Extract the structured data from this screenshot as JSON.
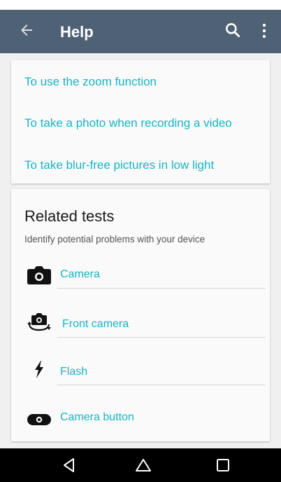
{
  "app_bar": {
    "title": "Help",
    "back_icon": "arrow-back-icon",
    "search_icon": "search-icon",
    "more_icon": "more-vertical-icon",
    "color": "#4f6175"
  },
  "topics": [
    {
      "label": "To use the zoom function"
    },
    {
      "label": "To take a photo when recording a video"
    },
    {
      "label": "To take blur-free pictures in low light"
    }
  ],
  "related_tests": {
    "heading": "Related tests",
    "subtitle": "Identify potential problems with your device",
    "items": [
      {
        "label": "Camera",
        "icon": "camera-icon"
      },
      {
        "label": "Front camera",
        "icon": "front-camera-icon"
      },
      {
        "label": "Flash",
        "icon": "flash-icon"
      },
      {
        "label": "Camera button",
        "icon": "camera-button-icon"
      }
    ]
  },
  "nav_bar": {
    "back_icon": "nav-back-icon",
    "home_icon": "nav-home-icon",
    "recents_icon": "nav-recents-icon"
  },
  "colors": {
    "accent": "#16b4c4",
    "background": "#f0f0f0"
  }
}
